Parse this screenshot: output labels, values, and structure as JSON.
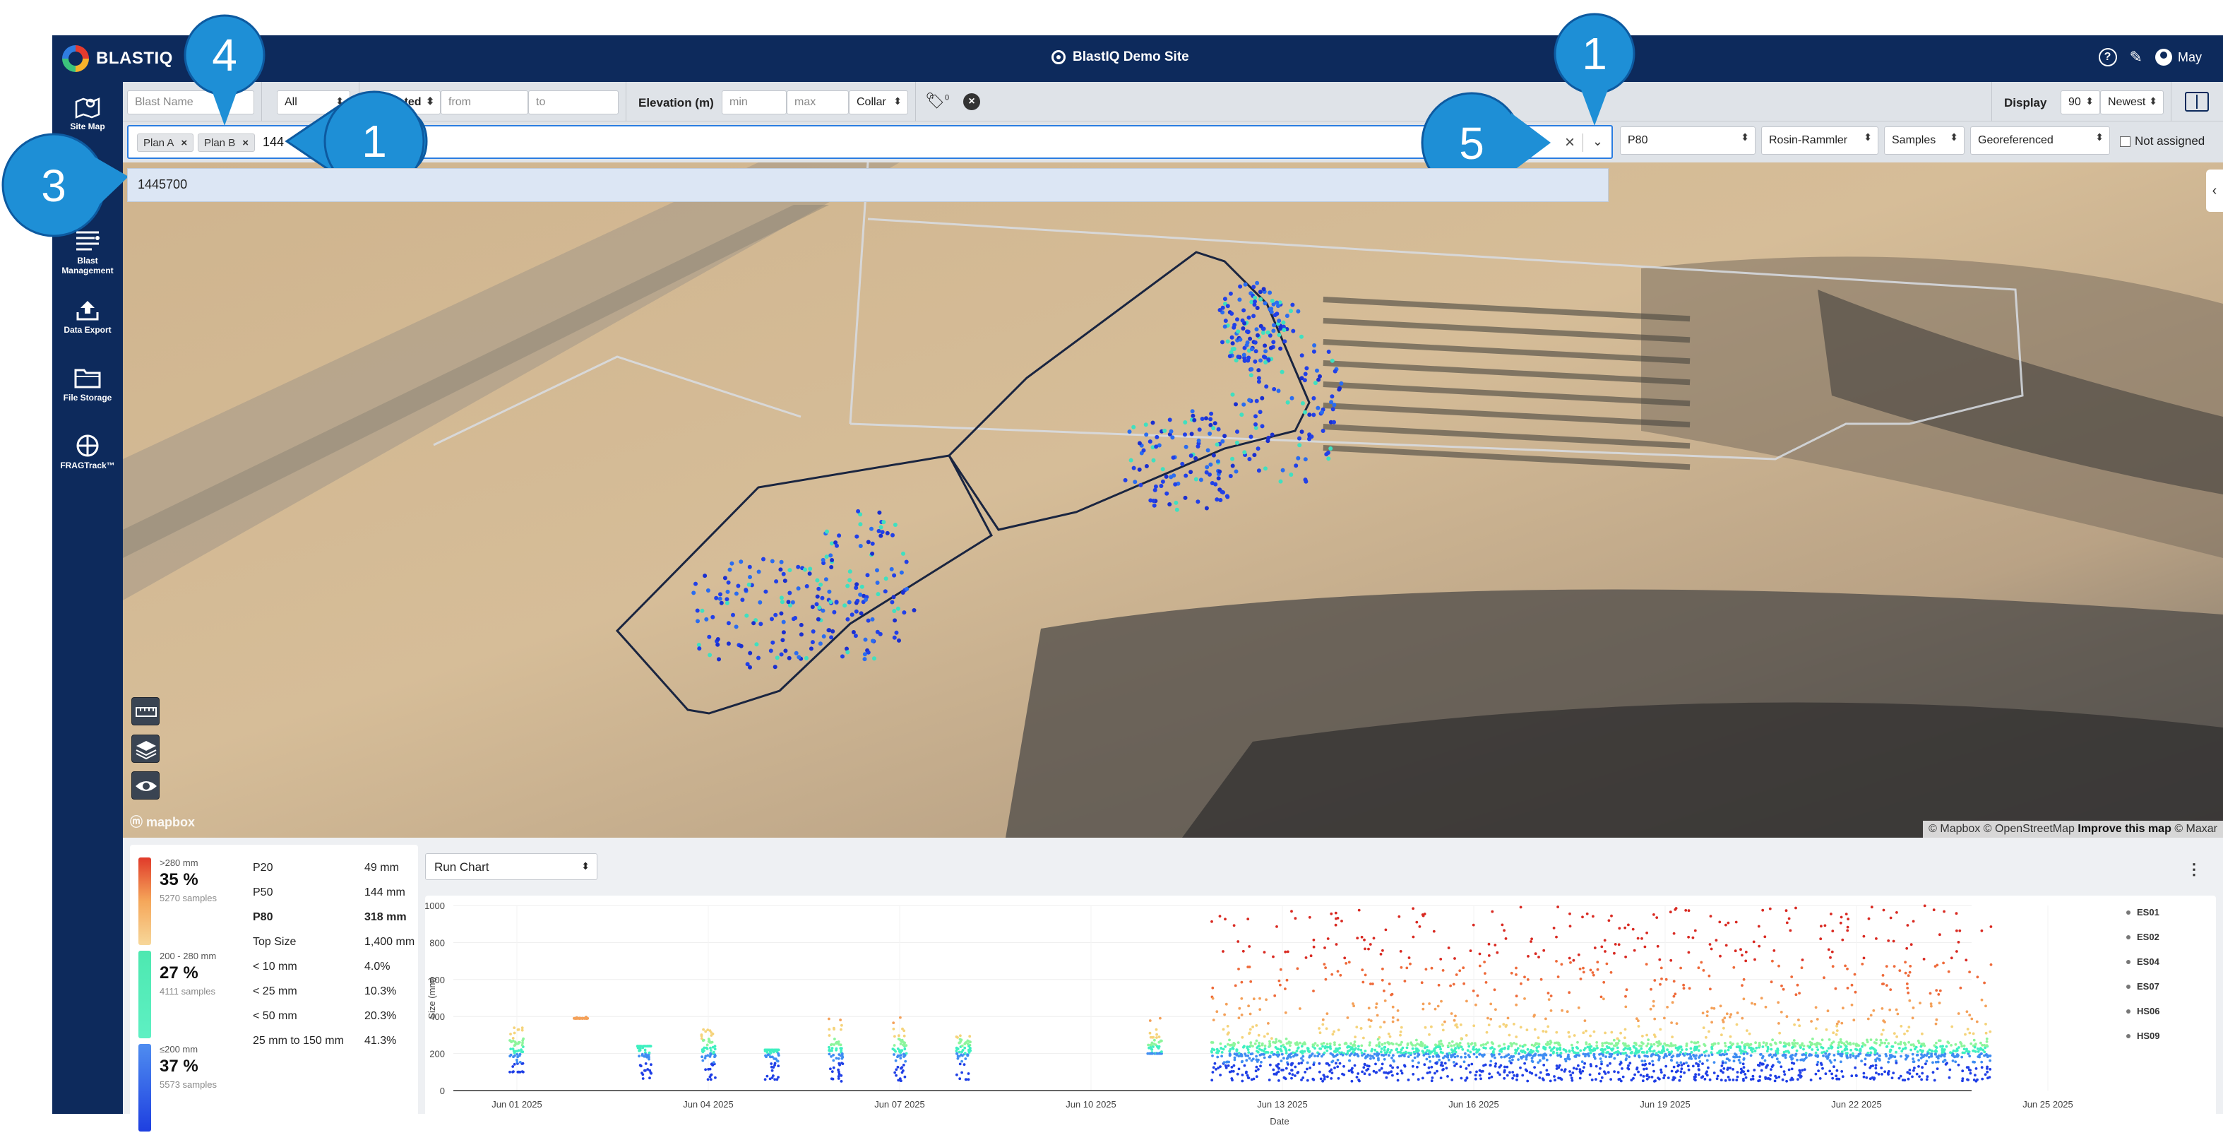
{
  "app": {
    "brand": "BLASTIQ",
    "site_title": "BlastIQ Demo Site",
    "user": "May",
    "colors": {
      "navy": "#0d2a5c",
      "accent": "#2a7de1",
      "callout": "#1e8fd6"
    }
  },
  "sidebar": {
    "items": [
      {
        "label": "Site Map",
        "icon": "map-icon"
      },
      {
        "label": "Blast Management",
        "icon": "list-icon"
      },
      {
        "label": "Data Export",
        "icon": "upload-icon"
      },
      {
        "label": "File Storage",
        "icon": "folder-icon"
      },
      {
        "label": "FRAGTrack™",
        "icon": "crosshair-icon"
      }
    ]
  },
  "filters": {
    "blast_name_placeholder": "Blast Name",
    "all_select": "All",
    "created_select": "Created",
    "from_placeholder": "from",
    "to_placeholder": "to",
    "elevation_label": "Elevation (m)",
    "min_placeholder": "min",
    "max_placeholder": "max",
    "collar_select": "Collar",
    "tag_count": "0",
    "display_label": "Display",
    "display_count": "90",
    "sort_select": "Newest"
  },
  "search": {
    "chips": [
      "Plan A",
      "Plan B"
    ],
    "typed": "144",
    "dropdown_option": "1445700"
  },
  "selectors": {
    "metric": "P80",
    "model": "Rosin-Rammler",
    "source": "Samples",
    "reference": "Georeferenced",
    "not_assigned": "Not assigned"
  },
  "callouts": [
    "4",
    "1",
    "3",
    "5",
    "1"
  ],
  "map": {
    "attribution_mapbox": "© Mapbox",
    "attribution_osm": "© OpenStreetMap",
    "attribution_improve": "Improve this map",
    "attribution_maxar": "© Maxar",
    "logo": "mapbox"
  },
  "stats": {
    "bands": [
      {
        "range": ">280 mm",
        "pct": "35 %",
        "samples": "5270 samples"
      },
      {
        "range": "200 - 280 mm",
        "pct": "27 %",
        "samples": "4111 samples"
      },
      {
        "range": "≤200 mm",
        "pct": "37 %",
        "samples": "5573 samples"
      }
    ],
    "rows": [
      {
        "label": "P20",
        "value": "49 mm"
      },
      {
        "label": "P50",
        "value": "144 mm"
      },
      {
        "label": "P80",
        "value": "318 mm"
      },
      {
        "label": "Top Size",
        "value": "1,400 mm"
      },
      {
        "label": "< 10 mm",
        "value": "4.0%"
      },
      {
        "label": "< 25 mm",
        "value": "10.3%"
      },
      {
        "label": "< 50 mm",
        "value": "20.3%"
      },
      {
        "label": "25 mm to 150 mm",
        "value": "41.3%"
      }
    ]
  },
  "chart": {
    "select": "Run Chart"
  },
  "chart_data": {
    "type": "scatter",
    "xlabel": "Date",
    "ylabel": "Size (mm)",
    "ylim": [
      0,
      1000
    ],
    "yticks": [
      0,
      200,
      400,
      600,
      800,
      1000
    ],
    "xticks": [
      "Jun 01 2025",
      "Jun 04 2025",
      "Jun 07 2025",
      "Jun 10 2025",
      "Jun 13 2025",
      "Jun 16 2025",
      "Jun 19 2025",
      "Jun 22 2025",
      "Jun 25 2025"
    ],
    "legend": [
      "ES01",
      "ES02",
      "ES04",
      "ES07",
      "HS06",
      "HS09"
    ],
    "legend_position": "right",
    "color_scale": "size: blue (low) to red (high)",
    "clusters": [
      {
        "start": "Jun 01 2025",
        "end": "Jun 01 2025",
        "min": 100,
        "max": 340
      },
      {
        "start": "Jun 02 2025",
        "end": "Jun 02 2025",
        "min": 390,
        "max": 400
      },
      {
        "start": "Jun 03 2025",
        "end": "Jun 03 2025",
        "min": 30,
        "max": 240
      },
      {
        "start": "Jun 04 2025",
        "end": "Jun 04 2025",
        "min": 60,
        "max": 330
      },
      {
        "start": "Jun 05 2025",
        "end": "Jun 05 2025",
        "min": 60,
        "max": 220
      },
      {
        "start": "Jun 06 2025",
        "end": "Jun 06 2025",
        "min": 40,
        "max": 410
      },
      {
        "start": "Jun 07 2025",
        "end": "Jun 07 2025",
        "min": 30,
        "max": 400
      },
      {
        "start": "Jun 08 2025",
        "end": "Jun 08 2025",
        "min": 60,
        "max": 300
      },
      {
        "start": "Jun 11 2025",
        "end": "Jun 11 2025",
        "min": 200,
        "max": 400
      },
      {
        "start": "Jun 12 2025",
        "end": "Jun 24 2025",
        "min": 0,
        "max": 1000
      }
    ]
  }
}
